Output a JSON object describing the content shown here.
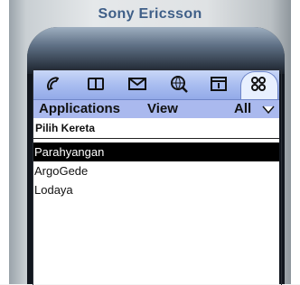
{
  "device": {
    "brand": "Sony Ericsson"
  },
  "toolbar": {
    "icons": [
      {
        "name": "phone-icon"
      },
      {
        "name": "book-icon"
      },
      {
        "name": "envelope-icon"
      },
      {
        "name": "globe-search-icon"
      },
      {
        "name": "calendar-icon"
      },
      {
        "name": "apps-grid-icon",
        "selected": true
      }
    ]
  },
  "menu": {
    "left": "Applications",
    "middle": "View",
    "right": "All"
  },
  "screen": {
    "title": "Pilih Kereta",
    "items": [
      {
        "label": "Parahyangan",
        "selected": true
      },
      {
        "label": "ArgoGede",
        "selected": false
      },
      {
        "label": "Lodaya",
        "selected": false
      }
    ]
  },
  "colors": {
    "brand": "#3f5f88",
    "toolbar": "#a9bdf0",
    "menubar": "#aab9ee",
    "selection": "#000000"
  }
}
